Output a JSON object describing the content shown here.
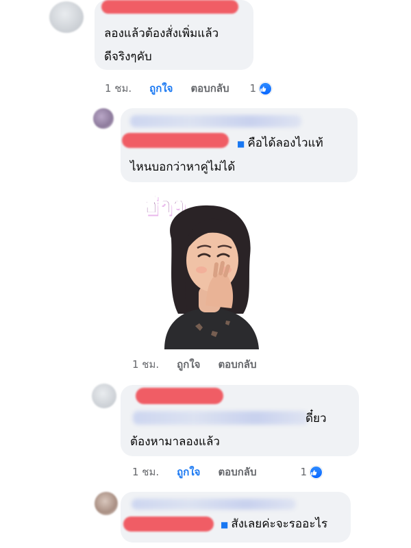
{
  "colors": {
    "like_active": "#1877f2",
    "meta_text": "#65676b",
    "bubble_bg": "#f0f2f5",
    "redaction": "#f0565e"
  },
  "comments": [
    {
      "lines": [
        "ลองแล้วต้องสั่งเพิ่มแล้ว",
        "ดีจริงๆคับ"
      ],
      "meta": {
        "time": "1 ชม.",
        "like": "ถูกใจ",
        "reply": "ตอบกลับ",
        "reactions": "1"
      },
      "like_active": true
    },
    {
      "lines": [
        "คือได้ลองไวแท้",
        "ไหนบอกว่าหาคู่ไม่ได้"
      ],
      "sticker_text": "ฮ่าๆ",
      "meta": {
        "time": "1 ชม.",
        "like": "ถูกใจ",
        "reply": "ตอบกลับ"
      },
      "like_active": false
    },
    {
      "lines": [
        "ดี๋ยว",
        "ต้องหามาลองแล้ว"
      ],
      "meta": {
        "time": "1 ชม.",
        "like": "ถูกใจ",
        "reply": "ตอบกลับ",
        "reactions": "1"
      },
      "like_active": true
    },
    {
      "lines": [
        "สังเลยค่ะจะรออะไร"
      ],
      "meta": {},
      "like_active": false
    }
  ],
  "icons": {
    "like_reaction": "thumbs-up-icon"
  }
}
